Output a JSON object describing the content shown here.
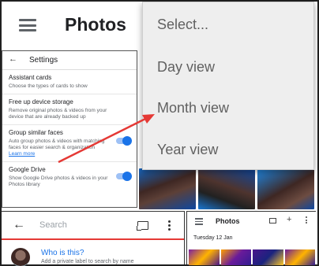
{
  "app": {
    "title": "Photos"
  },
  "menu": {
    "items": [
      {
        "label": "Select..."
      },
      {
        "label": "Day view"
      },
      {
        "label": "Month view"
      },
      {
        "label": "Year view"
      }
    ]
  },
  "settings": {
    "title": "Settings",
    "back_icon": "arrow-back-icon",
    "items": [
      {
        "title": "Assistant cards",
        "desc": "Choose the types of cards to show"
      },
      {
        "title": "Free up device storage",
        "desc": "Remove original photos & videos from your device that are already backed up"
      },
      {
        "title": "Group similar faces",
        "desc": "Auto group photos & videos with matching faces for easier search & organization",
        "link": "Learn more",
        "toggle_on": true
      },
      {
        "title": "Google Drive",
        "desc": "Show Google Drive photos & videos in your Photos library",
        "toggle_on": true
      }
    ]
  },
  "search": {
    "placeholder": "Search",
    "who_title": "Who is this?",
    "who_desc": "Add a private label to search by name"
  },
  "mini": {
    "title": "Photos",
    "date": "Tuesday 12 Jan"
  },
  "colors": {
    "accent": "#1a73e8",
    "arrow": "#e53935",
    "menu_bg": "#eeeeee"
  }
}
